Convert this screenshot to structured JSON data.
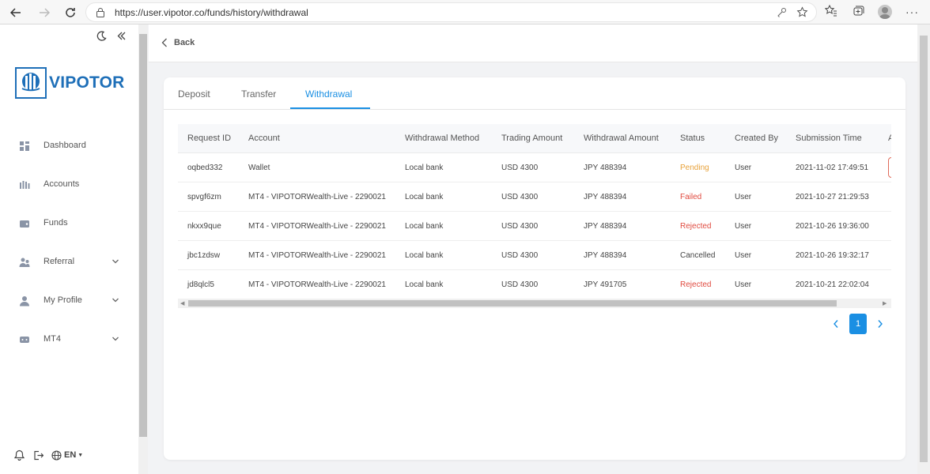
{
  "browser": {
    "url": "https://user.vipotor.co/funds/history/withdrawal"
  },
  "brand": {
    "name": "VIPOTOR",
    "color": "#1e6fb8",
    "accent": "#1a8fe3"
  },
  "sidebar": {
    "items": [
      {
        "label": "Dashboard",
        "icon": "dashboard-icon",
        "has_chevron": false
      },
      {
        "label": "Accounts",
        "icon": "accounts-icon",
        "has_chevron": false
      },
      {
        "label": "Funds",
        "icon": "wallet-icon",
        "has_chevron": false
      },
      {
        "label": "Referral",
        "icon": "referral-icon",
        "has_chevron": true
      },
      {
        "label": "My Profile",
        "icon": "user-icon",
        "has_chevron": true
      },
      {
        "label": "MT4",
        "icon": "mt4-icon",
        "has_chevron": true
      }
    ],
    "language": "EN"
  },
  "header": {
    "back_label": "Back"
  },
  "tabs": {
    "items": [
      {
        "label": "Deposit"
      },
      {
        "label": "Transfer"
      },
      {
        "label": "Withdrawal"
      }
    ],
    "active": "Withdrawal"
  },
  "table": {
    "columns": [
      "Request ID",
      "Account",
      "Withdrawal Method",
      "Trading Amount",
      "Withdrawal Amount",
      "Status",
      "Created By",
      "Submission Time",
      "A"
    ],
    "rows": [
      {
        "id": "oqbed332",
        "account": "Wallet",
        "method": "Local bank",
        "trading": "USD 4300",
        "withdrawal": "JPY 488394",
        "status": "Pending",
        "created_by": "User",
        "time": "2021-11-02 17:49:51"
      },
      {
        "id": "spvgf6zm",
        "account": "MT4 - VIPOTORWealth-Live - 2290021",
        "method": "Local bank",
        "trading": "USD 4300",
        "withdrawal": "JPY 488394",
        "status": "Failed",
        "created_by": "User",
        "time": "2021-10-27 21:29:53"
      },
      {
        "id": "nkxx9que",
        "account": "MT4 - VIPOTORWealth-Live - 2290021",
        "method": "Local bank",
        "trading": "USD 4300",
        "withdrawal": "JPY 488394",
        "status": "Rejected",
        "created_by": "User",
        "time": "2021-10-26 19:36:00"
      },
      {
        "id": "jbc1zdsw",
        "account": "MT4 - VIPOTORWealth-Live - 2290021",
        "method": "Local bank",
        "trading": "USD 4300",
        "withdrawal": "JPY 488394",
        "status": "Cancelled",
        "created_by": "User",
        "time": "2021-10-26 19:32:17"
      },
      {
        "id": "jd8qlcl5",
        "account": "MT4 - VIPOTORWealth-Live - 2290021",
        "method": "Local bank",
        "trading": "USD 4300",
        "withdrawal": "JPY 491705",
        "status": "Rejected",
        "created_by": "User",
        "time": "2021-10-21 22:02:04"
      }
    ]
  },
  "pagination": {
    "current": "1"
  },
  "status_colors": {
    "Pending": "#e8a23b",
    "Failed": "#e04a3f",
    "Rejected": "#e04a3f",
    "Cancelled": "#444444"
  }
}
